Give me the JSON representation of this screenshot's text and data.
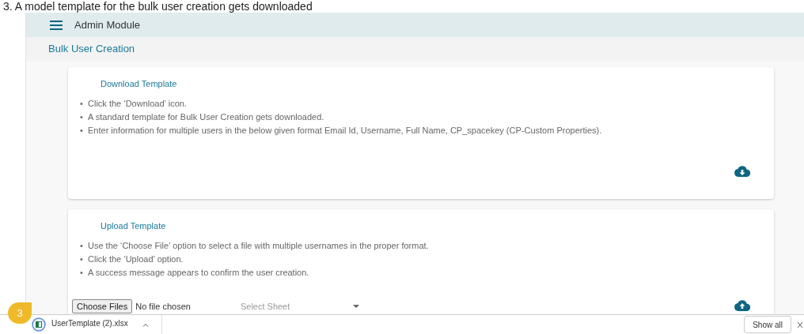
{
  "step_heading": "3.  A model template for the bulk user creation gets downloaded",
  "app": {
    "title": "Admin Module",
    "breadcrumb": "Bulk User Creation",
    "download_card": {
      "title": "Download Template",
      "bullets": [
        {
          "marker": "•",
          "text": "Click the ‘Download’ icon."
        },
        {
          "marker": "•",
          "text": "A standard template for Bulk User Creation gets downloaded."
        },
        {
          "marker": "•",
          "text": "Enter information for multiple users in the below given format Email Id, Username, Full Name, CP_spacekey (CP-Custom Properties)."
        }
      ]
    },
    "upload_card": {
      "title": "Upload Template",
      "bullets": [
        {
          "marker": "•",
          "text": "Use the ‘Choose File’ option to select a file with multiple usernames in the proper format."
        },
        {
          "marker": "•",
          "text": "Click the ‘Upload’ option."
        },
        {
          "marker": "•",
          "text": "A success message appears to confirm the user creation."
        }
      ],
      "choose_button": "Choose Files",
      "file_status": "No file chosen",
      "sheet_select": {
        "placeholder": "Select Sheet"
      }
    }
  },
  "callout": "3",
  "download_bar": {
    "file_name": "UserTemplate (2).xlsx",
    "show_all": "Show all"
  }
}
